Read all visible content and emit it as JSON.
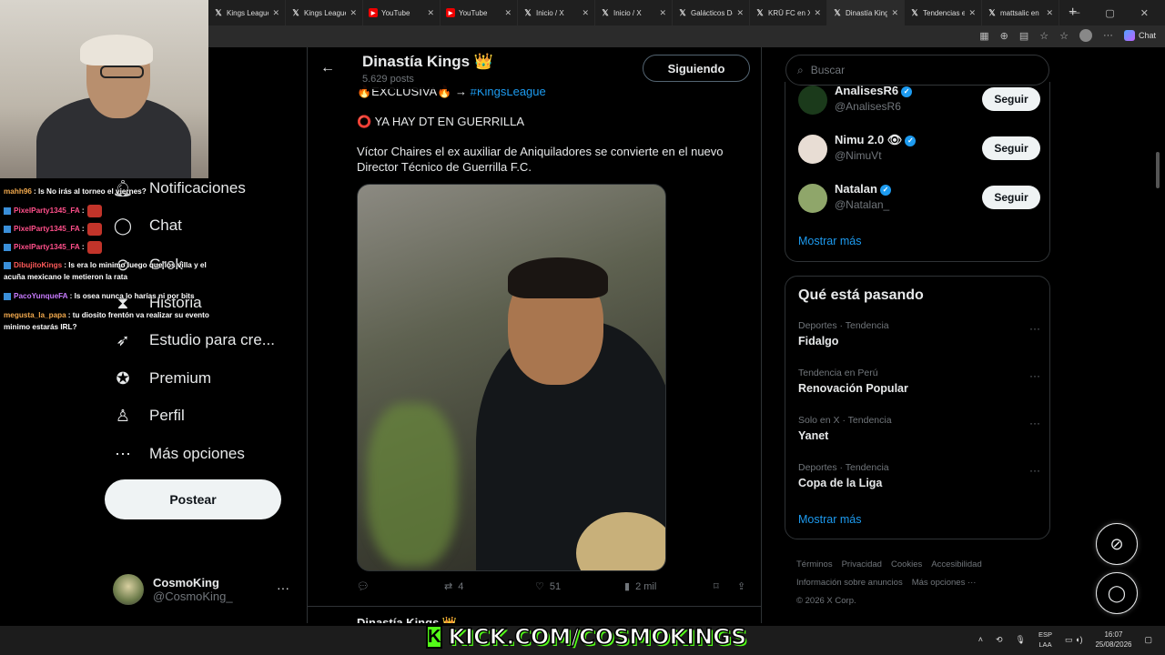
{
  "browser": {
    "tabs": [
      {
        "label": "Kings League",
        "icon": "x-icon"
      },
      {
        "label": "Kings League",
        "icon": "x-icon"
      },
      {
        "label": "YouTube",
        "icon": "youtube-icon"
      },
      {
        "label": "YouTube",
        "icon": "youtube-icon"
      },
      {
        "label": "Inicio / X",
        "icon": "x-icon"
      },
      {
        "label": "Inicio / X",
        "icon": "x-icon"
      },
      {
        "label": "Galácticos De",
        "icon": "x-icon"
      },
      {
        "label": "KRÜ FC en X",
        "icon": "x-icon"
      },
      {
        "label": "Dinastía King",
        "icon": "x-icon"
      },
      {
        "label": "Tendencias en",
        "icon": "x-icon"
      },
      {
        "label": "mattsalic en",
        "icon": "x-icon"
      }
    ],
    "chat_label": "Chat"
  },
  "stream_chat": [
    {
      "user": "mahh96",
      "color": "#f2a94d",
      "text": ": ls No irás al torneo el viernes?"
    },
    {
      "user": "PixelParty1345_FA",
      "color": "#ff4f8a",
      "text": ":"
    },
    {
      "user": "PixelParty1345_FA",
      "color": "#ff4f8a",
      "text": ":"
    },
    {
      "user": "PixelParty1345_FA",
      "color": "#ff4f8a",
      "text": ":"
    },
    {
      "user": "DibujitoKings",
      "color": "#ff5a5a",
      "text": ": ls era lo minimo luego que los villa y el acuña mexicano le metieron la rata"
    },
    {
      "user": "PacoYunqueFA",
      "color": "#c87bff",
      "text": ": ls osea nunca lo harías ni por bits"
    },
    {
      "user": "megusta_la_papa",
      "color": "#f2a94d",
      "text": ": tu diosito frentón va realizar su evento minimo estarás IRL?"
    }
  ],
  "nav": {
    "items": [
      {
        "label": "Notificaciones",
        "icon": "bell-icon"
      },
      {
        "label": "Chat",
        "icon": "chat-icon"
      },
      {
        "label": "Grok",
        "icon": "grok-icon"
      },
      {
        "label": "Historia",
        "icon": "history-icon"
      },
      {
        "label": "Estudio para cre...",
        "icon": "rocket-icon"
      },
      {
        "label": "Premium",
        "icon": "premium-icon"
      },
      {
        "label": "Perfil",
        "icon": "person-icon"
      },
      {
        "label": "Más opciones",
        "icon": "more-icon"
      }
    ],
    "post_button": "Postear",
    "account": {
      "name": "CosmoKing",
      "handle": "@CosmoKing_"
    }
  },
  "profile_header": {
    "name": "Dinastía Kings 👑",
    "posts": "5.629 posts",
    "follow_label": "Siguiendo"
  },
  "tweet": {
    "line1_prefix": "🔥EXCLUSIVA🔥 → ",
    "hashtag": "#KingsLeague",
    "line2": "⭕ YA HAY DT EN GUERRILLA",
    "line3": "Víctor Chaires el ex auxiliar de Aniquiladores se convierte en el nuevo Director Técnico de Guerrilla F.C.",
    "reposts": "4",
    "likes": "51",
    "views": "2 mil"
  },
  "next_tweet": {
    "author": "Dinastía Kings 👑"
  },
  "search": {
    "placeholder": "Buscar"
  },
  "who_to_follow": {
    "users": [
      {
        "name": "AnalisesR6",
        "handle": "@AnalisesR6",
        "avatar_color": "#1b3a1b"
      },
      {
        "name": "Nimu 2.0 👁",
        "handle": "@NimuVt",
        "avatar_color": "#e8ddd4"
      },
      {
        "name": "Natalan",
        "handle": "@Natalan_",
        "avatar_color": "#8fa66a"
      }
    ],
    "follow_label": "Seguir",
    "show_more": "Mostrar más"
  },
  "trends": {
    "title": "Qué está pasando",
    "items": [
      {
        "meta": "Deportes · Tendencia",
        "name": "Fidalgo"
      },
      {
        "meta": "Tendencia en Perú",
        "name": "Renovación Popular"
      },
      {
        "meta": "Solo en X · Tendencia",
        "name": "Yanet"
      },
      {
        "meta": "Deportes · Tendencia",
        "name": "Copa de la Liga"
      }
    ],
    "show_more": "Mostrar más"
  },
  "footer": {
    "links": [
      "Términos",
      "Privacidad",
      "Cookies",
      "Accesibilidad",
      "Información sobre anuncios",
      "Más opciones ···"
    ],
    "copyright": "© 2026 X Corp."
  },
  "overlay": {
    "kick_text": "KICK.COM/COSMOKINGS"
  },
  "taskbar": {
    "lang_top": "ESP",
    "lang_bottom": "LAA",
    "time": "16:07",
    "date": "25/08/2026"
  }
}
